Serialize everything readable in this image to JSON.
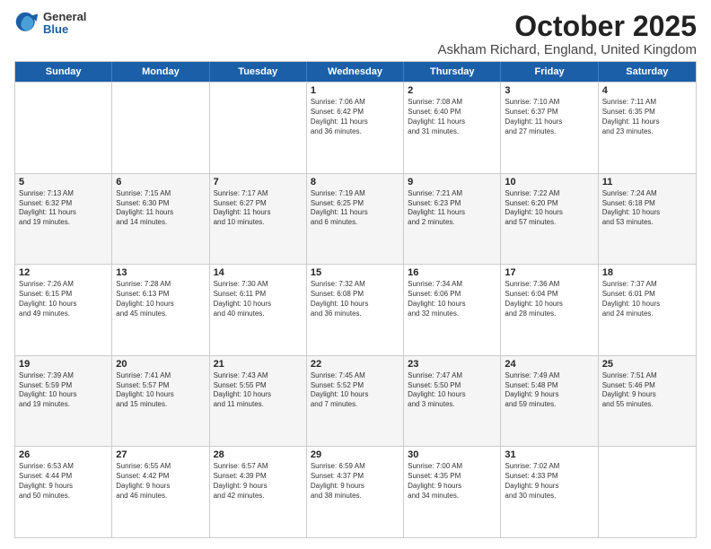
{
  "logo": {
    "general": "General",
    "blue": "Blue"
  },
  "title": "October 2025",
  "location": "Askham Richard, England, United Kingdom",
  "dayHeaders": [
    "Sunday",
    "Monday",
    "Tuesday",
    "Wednesday",
    "Thursday",
    "Friday",
    "Saturday"
  ],
  "weeks": [
    [
      {
        "day": "",
        "info": ""
      },
      {
        "day": "",
        "info": ""
      },
      {
        "day": "",
        "info": ""
      },
      {
        "day": "1",
        "info": "Sunrise: 7:06 AM\nSunset: 6:42 PM\nDaylight: 11 hours\nand 36 minutes."
      },
      {
        "day": "2",
        "info": "Sunrise: 7:08 AM\nSunset: 6:40 PM\nDaylight: 11 hours\nand 31 minutes."
      },
      {
        "day": "3",
        "info": "Sunrise: 7:10 AM\nSunset: 6:37 PM\nDaylight: 11 hours\nand 27 minutes."
      },
      {
        "day": "4",
        "info": "Sunrise: 7:11 AM\nSunset: 6:35 PM\nDaylight: 11 hours\nand 23 minutes."
      }
    ],
    [
      {
        "day": "5",
        "info": "Sunrise: 7:13 AM\nSunset: 6:32 PM\nDaylight: 11 hours\nand 19 minutes."
      },
      {
        "day": "6",
        "info": "Sunrise: 7:15 AM\nSunset: 6:30 PM\nDaylight: 11 hours\nand 14 minutes."
      },
      {
        "day": "7",
        "info": "Sunrise: 7:17 AM\nSunset: 6:27 PM\nDaylight: 11 hours\nand 10 minutes."
      },
      {
        "day": "8",
        "info": "Sunrise: 7:19 AM\nSunset: 6:25 PM\nDaylight: 11 hours\nand 6 minutes."
      },
      {
        "day": "9",
        "info": "Sunrise: 7:21 AM\nSunset: 6:23 PM\nDaylight: 11 hours\nand 2 minutes."
      },
      {
        "day": "10",
        "info": "Sunrise: 7:22 AM\nSunset: 6:20 PM\nDaylight: 10 hours\nand 57 minutes."
      },
      {
        "day": "11",
        "info": "Sunrise: 7:24 AM\nSunset: 6:18 PM\nDaylight: 10 hours\nand 53 minutes."
      }
    ],
    [
      {
        "day": "12",
        "info": "Sunrise: 7:26 AM\nSunset: 6:15 PM\nDaylight: 10 hours\nand 49 minutes."
      },
      {
        "day": "13",
        "info": "Sunrise: 7:28 AM\nSunset: 6:13 PM\nDaylight: 10 hours\nand 45 minutes."
      },
      {
        "day": "14",
        "info": "Sunrise: 7:30 AM\nSunset: 6:11 PM\nDaylight: 10 hours\nand 40 minutes."
      },
      {
        "day": "15",
        "info": "Sunrise: 7:32 AM\nSunset: 6:08 PM\nDaylight: 10 hours\nand 36 minutes."
      },
      {
        "day": "16",
        "info": "Sunrise: 7:34 AM\nSunset: 6:06 PM\nDaylight: 10 hours\nand 32 minutes."
      },
      {
        "day": "17",
        "info": "Sunrise: 7:36 AM\nSunset: 6:04 PM\nDaylight: 10 hours\nand 28 minutes."
      },
      {
        "day": "18",
        "info": "Sunrise: 7:37 AM\nSunset: 6:01 PM\nDaylight: 10 hours\nand 24 minutes."
      }
    ],
    [
      {
        "day": "19",
        "info": "Sunrise: 7:39 AM\nSunset: 5:59 PM\nDaylight: 10 hours\nand 19 minutes."
      },
      {
        "day": "20",
        "info": "Sunrise: 7:41 AM\nSunset: 5:57 PM\nDaylight: 10 hours\nand 15 minutes."
      },
      {
        "day": "21",
        "info": "Sunrise: 7:43 AM\nSunset: 5:55 PM\nDaylight: 10 hours\nand 11 minutes."
      },
      {
        "day": "22",
        "info": "Sunrise: 7:45 AM\nSunset: 5:52 PM\nDaylight: 10 hours\nand 7 minutes."
      },
      {
        "day": "23",
        "info": "Sunrise: 7:47 AM\nSunset: 5:50 PM\nDaylight: 10 hours\nand 3 minutes."
      },
      {
        "day": "24",
        "info": "Sunrise: 7:49 AM\nSunset: 5:48 PM\nDaylight: 9 hours\nand 59 minutes."
      },
      {
        "day": "25",
        "info": "Sunrise: 7:51 AM\nSunset: 5:46 PM\nDaylight: 9 hours\nand 55 minutes."
      }
    ],
    [
      {
        "day": "26",
        "info": "Sunrise: 6:53 AM\nSunset: 4:44 PM\nDaylight: 9 hours\nand 50 minutes."
      },
      {
        "day": "27",
        "info": "Sunrise: 6:55 AM\nSunset: 4:42 PM\nDaylight: 9 hours\nand 46 minutes."
      },
      {
        "day": "28",
        "info": "Sunrise: 6:57 AM\nSunset: 4:39 PM\nDaylight: 9 hours\nand 42 minutes."
      },
      {
        "day": "29",
        "info": "Sunrise: 6:59 AM\nSunset: 4:37 PM\nDaylight: 9 hours\nand 38 minutes."
      },
      {
        "day": "30",
        "info": "Sunrise: 7:00 AM\nSunset: 4:35 PM\nDaylight: 9 hours\nand 34 minutes."
      },
      {
        "day": "31",
        "info": "Sunrise: 7:02 AM\nSunset: 4:33 PM\nDaylight: 9 hours\nand 30 minutes."
      },
      {
        "day": "",
        "info": ""
      }
    ]
  ]
}
